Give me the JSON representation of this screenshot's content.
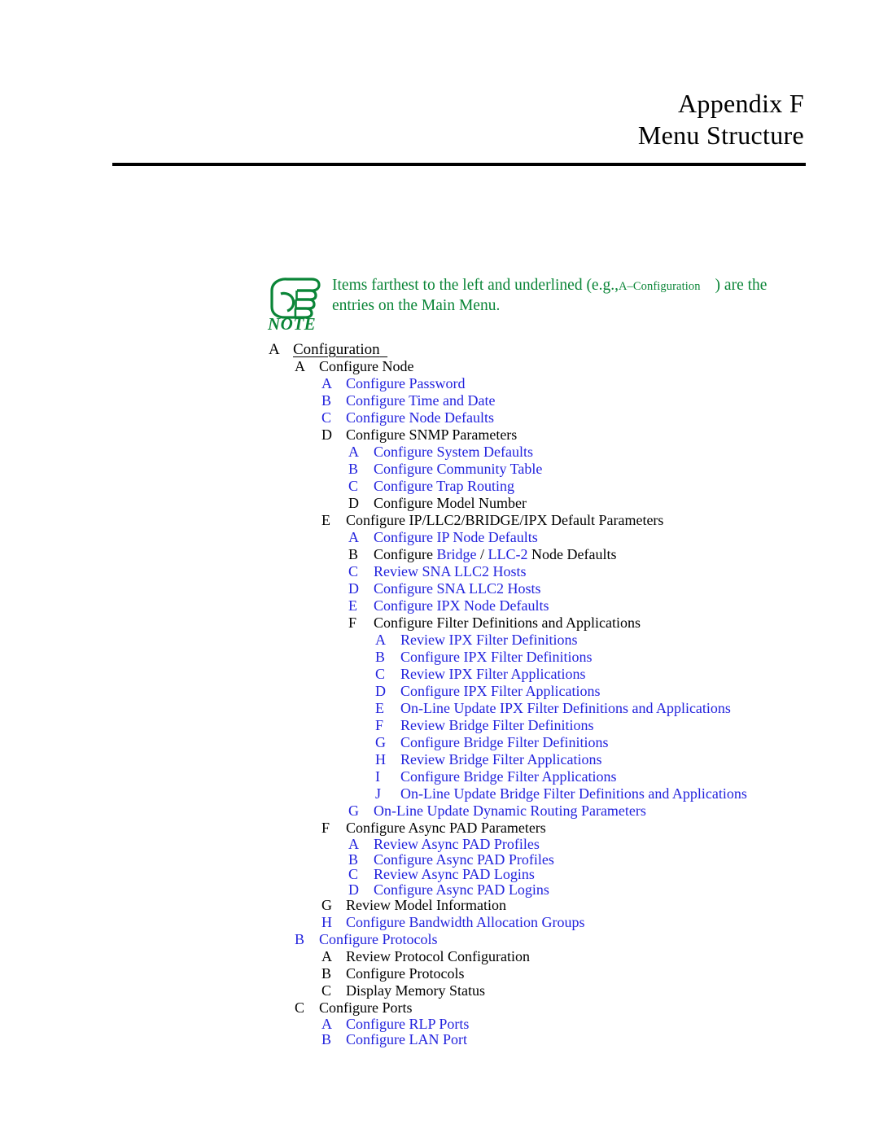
{
  "header": {
    "line1": "Appendix F",
    "line2": "Menu Structure"
  },
  "note": {
    "icon": "pointing-hand-note-icon",
    "icon_label": "NOTE",
    "color": "#0a8537",
    "line1_part1": "Items farthest to the left and underlined (e.g.,",
    "line1_example": "A–Configuration",
    "line1_part2": ") are the",
    "line2": "entries on the Main Menu."
  },
  "colors": {
    "leaf_blue": "#2222dd",
    "parent_black": "#000000",
    "note_green": "#0a8537"
  },
  "menu": {
    "rows": [
      {
        "level": 0,
        "letter": "A",
        "label": "Configuration",
        "color": "black",
        "underline": true
      },
      {
        "level": 1,
        "letter": "A",
        "label": "Configure Node",
        "color": "black"
      },
      {
        "level": 2,
        "letter": "A",
        "label": "Configure Password",
        "color": "blue"
      },
      {
        "level": 2,
        "letter": "B",
        "label": "Configure Time and Date",
        "color": "blue"
      },
      {
        "level": 2,
        "letter": "C",
        "label": "Configure Node Defaults",
        "color": "blue"
      },
      {
        "level": 2,
        "letter": "D",
        "label": "Configure SNMP Parameters",
        "color": "black"
      },
      {
        "level": 3,
        "letter": "A",
        "label": "Configure System Defaults",
        "color": "blue"
      },
      {
        "level": 3,
        "letter": "B",
        "label": "Configure  Community Table",
        "color": "blue"
      },
      {
        "level": 3,
        "letter": "C",
        "label": "Configure  Trap Routing",
        "color": "blue"
      },
      {
        "level": 3,
        "letter": "D",
        "label": "Configure Model Number",
        "color": "black"
      },
      {
        "level": 2,
        "letter": "E",
        "label": "Configure IP/LLC2/BRIDGE/IPX Default Parameters",
        "color": "black"
      },
      {
        "level": 3,
        "letter": "A",
        "label": "Configure IP Node Defaults",
        "color": "blue"
      },
      {
        "level": 3,
        "letter": "B",
        "label": "Configure   Bridge  / LLC-2  Node Defaults",
        "color": "mixed",
        "segments": [
          {
            "text": "Configure  ",
            "color": "black"
          },
          {
            "text": " Bridge ",
            "color": "blue"
          },
          {
            "text": " / ",
            "color": "black"
          },
          {
            "text": "LLC-2",
            "color": "blue"
          },
          {
            "text": "  Node Defaults",
            "color": "black"
          }
        ]
      },
      {
        "level": 3,
        "letter": "C",
        "label": "Review SNA LLC2 Hosts",
        "color": "blue"
      },
      {
        "level": 3,
        "letter": "D",
        "label": "Configure SNA LLC2 Hosts",
        "color": "blue"
      },
      {
        "level": 3,
        "letter": "E",
        "label": "Configure IPX Node Defaults",
        "color": "blue"
      },
      {
        "level": 3,
        "letter": "F",
        "label": "Configure Filter Definitions and Applications",
        "color": "black"
      },
      {
        "level": 4,
        "letter": "A",
        "label": "Review IPX Filter Definitions",
        "color": "blue"
      },
      {
        "level": 4,
        "letter": "B",
        "label": "Configure IPX Filter Definitions",
        "color": "blue"
      },
      {
        "level": 4,
        "letter": "C",
        "label": "Review IPX Filter Applications",
        "color": "blue"
      },
      {
        "level": 4,
        "letter": "D",
        "label": "Configure IPX Filter Applications",
        "color": "blue"
      },
      {
        "level": 4,
        "letter": "E",
        "label": "On-Line Update IPX Filter Definitions and Applications",
        "color": "blue"
      },
      {
        "level": 4,
        "letter": "F",
        "label": "Review Bridge Filter Definitions",
        "color": "blue"
      },
      {
        "level": 4,
        "letter": "G",
        "label": "Configure Bridge Filter Definitions",
        "color": "blue"
      },
      {
        "level": 4,
        "letter": "H",
        "label": "Review Bridge Filter Applications",
        "color": "blue"
      },
      {
        "level": 4,
        "letter": "I",
        "label": "Configure Bridge Filter Applications",
        "color": "blue"
      },
      {
        "level": 4,
        "letter": "J",
        "label": "On-Line Update Bridge Filter Definitions and Applications",
        "color": "blue"
      },
      {
        "level": 3,
        "letter": "G",
        "label": "On-Line Update Dynamic Routing Parameters",
        "color": "blue"
      },
      {
        "level": 2,
        "letter": "F",
        "label": "Configure Async PAD Parameters",
        "color": "black"
      },
      {
        "level": 3,
        "letter": "A",
        "label": "Review Async PAD Profiles",
        "color": "blue",
        "tight": true
      },
      {
        "level": 3,
        "letter": "B",
        "label": "Configure Async PAD Profiles",
        "color": "blue",
        "tight": true
      },
      {
        "level": 3,
        "letter": "C",
        "label": "Review Async PAD Logins",
        "color": "blue",
        "tight": true
      },
      {
        "level": 3,
        "letter": "D",
        "label": "Configure Async PAD Logins",
        "color": "blue",
        "tight": true
      },
      {
        "level": 2,
        "letter": "G",
        "label": "Review Model Information",
        "color": "black"
      },
      {
        "level": 2,
        "letter": "H",
        "label": "Configure Bandwidth Allocation Groups",
        "color": "blue"
      },
      {
        "level": 1,
        "letter": "B",
        "label": "Configure Protocols",
        "color": "blue"
      },
      {
        "level": 2,
        "letter": "A",
        "label": "Review Protocol Configuration",
        "color": "black"
      },
      {
        "level": 2,
        "letter": "B",
        "label": "Configure Protocols",
        "color": "black"
      },
      {
        "level": 2,
        "letter": "C",
        "label": "Display Memory Status",
        "color": "black"
      },
      {
        "level": 1,
        "letter": "C",
        "label": "Configure Ports",
        "color": "black"
      },
      {
        "level": 2,
        "letter": "A",
        "label": "Configure RLP Ports",
        "color": "blue",
        "tight": true
      },
      {
        "level": 2,
        "letter": "B",
        "label": "Configure LAN Port",
        "color": "blue",
        "tight": true
      }
    ]
  }
}
